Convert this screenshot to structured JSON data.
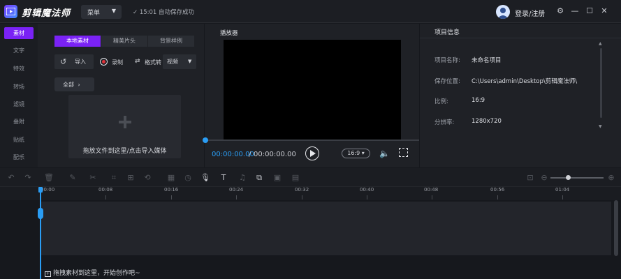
{
  "app": {
    "name": "剪辑魔法师",
    "menu_label": "菜单",
    "save_status": "15:01 自动保存成功",
    "login_label": "登录/注册"
  },
  "colors": {
    "accent": "#7a22f5",
    "playhead": "#2a9df4",
    "panel": "#1f2126",
    "bg": "#16181d"
  },
  "sidebar": {
    "items": [
      {
        "label": "素材",
        "active": true
      },
      {
        "label": "文字"
      },
      {
        "label": "特效"
      },
      {
        "label": "转场"
      },
      {
        "label": "滤镜"
      },
      {
        "label": "叠附"
      },
      {
        "label": "贴纸"
      },
      {
        "label": "配乐"
      }
    ]
  },
  "material": {
    "tabs": [
      "本地素材",
      "精美片头",
      "背景样例"
    ],
    "import_label": "导入",
    "record_label": "录制",
    "format_label": "格式转",
    "format_value": "视频",
    "all_label": "全部",
    "drop_hint": "拖放文件到这里/点击导入媒体"
  },
  "player": {
    "title": "播放器",
    "current_time": "00:00:00.00",
    "separator": "/",
    "total_time": "00:00:00.00",
    "ratio": "16:9"
  },
  "project_info": {
    "title": "项目信息",
    "rows": [
      {
        "label": "项目名称:",
        "value": "未命名项目"
      },
      {
        "label": "保存位置:",
        "value": "C:\\Users\\admin\\Desktop\\剪辑魔法师\\"
      },
      {
        "label": "比例:",
        "value": "16:9"
      },
      {
        "label": "分辨率:",
        "value": "1280x720"
      }
    ]
  },
  "timeline": {
    "ticks": [
      "00:00",
      "00:08",
      "00:16",
      "00:24",
      "00:32",
      "00:40",
      "00:48",
      "00:56",
      "01:04"
    ],
    "drag_hint": "拖拽素材到这里，开始创作吧~"
  }
}
